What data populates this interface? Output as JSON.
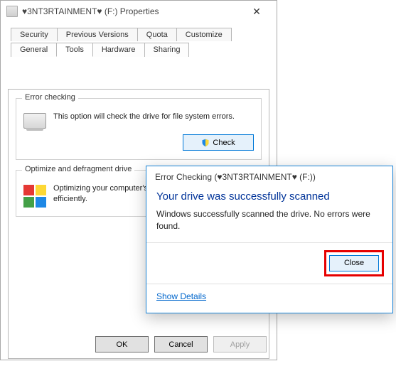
{
  "window": {
    "title": "♥3NT3RTAINMENT♥ (F:) Properties"
  },
  "tabs": {
    "row1": [
      "Security",
      "Previous Versions",
      "Quota",
      "Customize"
    ],
    "row2": [
      "General",
      "Tools",
      "Hardware",
      "Sharing"
    ],
    "active": "Tools"
  },
  "error_checking": {
    "legend": "Error checking",
    "text": "This option will check the drive for file system errors.",
    "button": "Check"
  },
  "defrag": {
    "legend": "Optimize and defragment drive",
    "text": "Optimizing your computer's drives can help it run more efficiently."
  },
  "footer": {
    "ok": "OK",
    "cancel": "Cancel",
    "apply": "Apply"
  },
  "dialog": {
    "title": "Error Checking (♥3NT3RTAINMENT♥ (F:))",
    "heading": "Your drive was successfully scanned",
    "body": "Windows successfully scanned the drive. No errors were found.",
    "close": "Close",
    "details": "Show Details"
  }
}
